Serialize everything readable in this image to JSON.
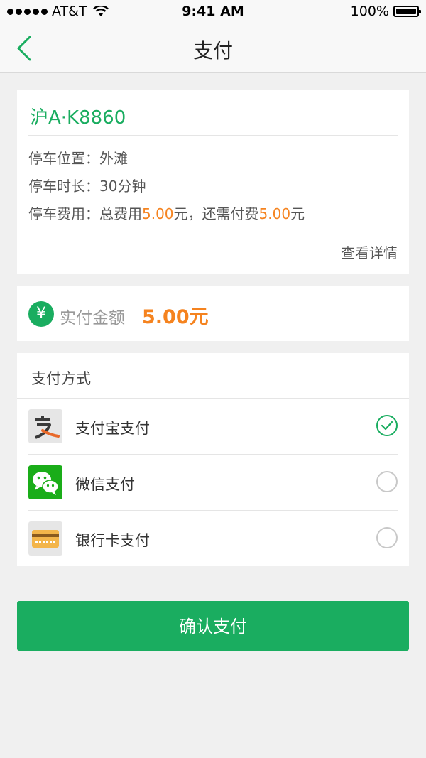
{
  "status_bar": {
    "carrier": "AT&T",
    "time": "9:41 AM",
    "battery": "100%"
  },
  "nav": {
    "title": "支付",
    "back_icon": "chevron-left-icon"
  },
  "parking": {
    "plate": "沪A·K8860",
    "location_label": "停车位置：",
    "location_value": "外滩",
    "duration_label": "停车时长：",
    "duration_value": "30分钟",
    "fee_label": "停车费用：",
    "fee_total_prefix": "总费用",
    "fee_total_value": "5.00",
    "fee_total_suffix": "元，还需付费",
    "fee_remaining_value": "5.00",
    "fee_remaining_suffix": "元",
    "detail_link": "查看详情"
  },
  "amount": {
    "icon_symbol": "¥",
    "label": "实付金额",
    "value": "5.00元"
  },
  "payment": {
    "header": "支付方式",
    "methods": [
      {
        "label": "支付宝支付",
        "icon": "alipay-icon",
        "selected": true
      },
      {
        "label": "微信支付",
        "icon": "wechat-icon",
        "selected": false
      },
      {
        "label": "银行卡支付",
        "icon": "bank-card-icon",
        "selected": false
      }
    ]
  },
  "confirm_button": "确认支付",
  "colors": {
    "accent_green": "#1aad60",
    "highlight_orange": "#f5831f"
  }
}
